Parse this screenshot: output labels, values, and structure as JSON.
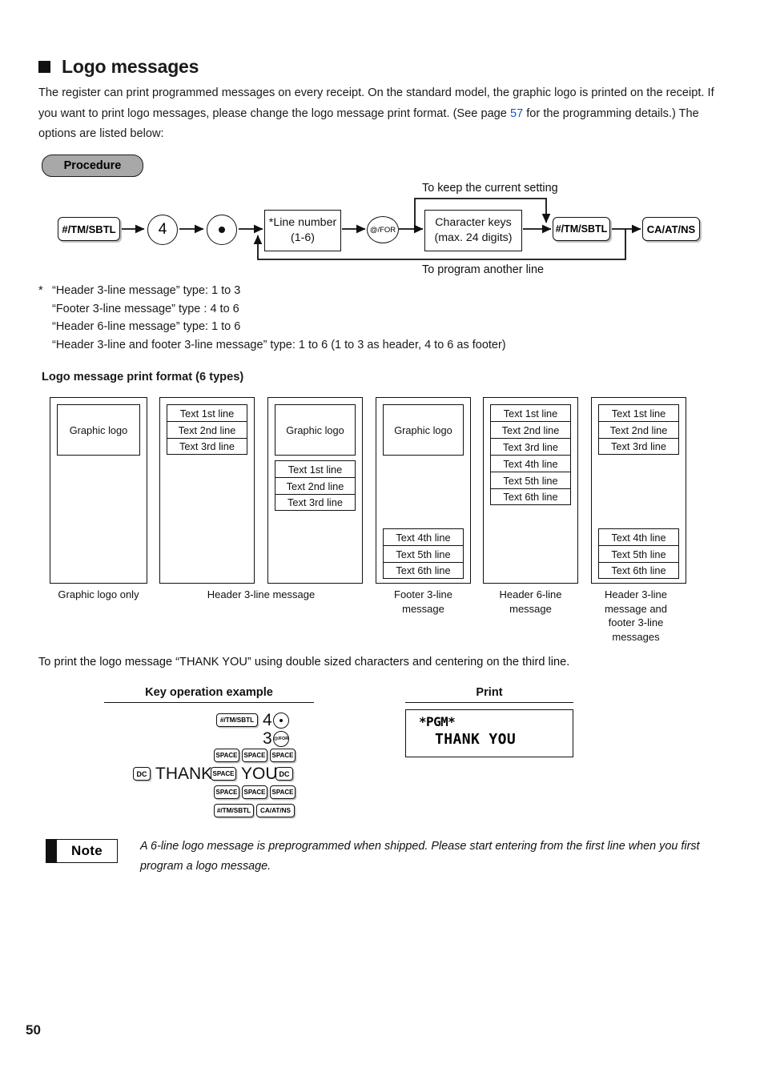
{
  "page": {
    "number": "50"
  },
  "heading": {
    "bullet_icon": "square-bullet-icon",
    "title": "Logo messages"
  },
  "intro": {
    "part1": "The register can print programmed messages on every receipt. On the standard model, the graphic logo is printed on the receipt.  If you want to print logo messages, please change the logo message print format. (See page ",
    "page_ref": "57",
    "part2": " for the programming details.)  The options are listed below:"
  },
  "procedure": {
    "badge": "Procedure",
    "keys": {
      "tmsbtl": "#/TM/SBTL",
      "four": "4",
      "dot": "•",
      "atfor": "@/FOR",
      "tmsbtl2": "#/TM/SBTL",
      "caatns": "CA/AT/NS"
    },
    "boxes": {
      "line_number_l1": "*Line number",
      "line_number_l2": "(1-6)",
      "char_keys_l1": "Character keys",
      "char_keys_l2": "(max. 24 digits)"
    },
    "labels": {
      "keep_setting": "To keep the current setting",
      "program_another": "To program another line"
    }
  },
  "footnote": {
    "star": "*",
    "lines": [
      "“Header 3-line message” type: 1 to 3",
      "“Footer 3-line message” type  : 4 to 6",
      "“Header 6-line message” type: 1 to 6",
      "“Header 3-line and footer 3-line message” type: 1 to 6 (1 to 3 as header, 4 to 6 as footer)"
    ]
  },
  "formats": {
    "subtitle": "Logo message print format (6 types)",
    "labels": {
      "graphic_logo": "Graphic logo",
      "line1": "Text 1st line",
      "line2": "Text 2nd line",
      "line3": "Text 3rd line",
      "line4": "Text 4th line",
      "line5": "Text 5th line",
      "line6": "Text 6th line"
    },
    "items": [
      {
        "caption": "Graphic logo only",
        "logo": "Graphic logo",
        "top_lines": [],
        "bottom_lines": []
      },
      {
        "caption": "Header 3-line message",
        "logo": null,
        "top_lines": [
          "Text 1st line",
          "Text 2nd line",
          "Text 3rd line"
        ],
        "bottom_lines": []
      },
      {
        "caption": "Header 3-line message",
        "logo": "Graphic logo",
        "top_lines": [
          "Text 1st line",
          "Text 2nd line",
          "Text 3rd line"
        ],
        "bottom_lines": []
      },
      {
        "caption": "Footer 3-line message",
        "logo": "Graphic logo",
        "top_lines": [],
        "bottom_lines": [
          "Text 4th line",
          "Text 5th line",
          "Text 6th line"
        ]
      },
      {
        "caption": "Header 6-line message",
        "logo": null,
        "top_lines": [
          "Text 1st line",
          "Text 2nd line",
          "Text 3rd line",
          "Text 4th line",
          "Text 5th line",
          "Text 6th line"
        ],
        "bottom_lines": []
      },
      {
        "caption": "Header 3-line message and footer 3-line messages",
        "logo": null,
        "top_lines": [
          "Text 1st line",
          "Text 2nd line",
          "Text 3rd line"
        ],
        "bottom_lines": [
          "Text 4th line",
          "Text 5th line",
          "Text 6th line"
        ]
      }
    ]
  },
  "example": {
    "sentence": "To print the logo message “THANK YOU” using double sized characters and centering on the third line.",
    "col_key_header": "Key operation example",
    "col_print_header": "Print",
    "keys": {
      "tmsbtl": "#/TM/SBTL",
      "four": "4",
      "dot": "•",
      "three": "3",
      "atfor": "@/FOR",
      "space": "SPACE",
      "dc": "DC",
      "thank": "THANK",
      "you": "YOU",
      "caatns": "CA/AT/NS"
    },
    "print": {
      "line1": "*PGM*",
      "line2": "THANK  YOU"
    }
  },
  "note": {
    "badge": "Note",
    "text": "A 6-line logo message is preprogrammed when shipped.  Please start entering from the first line when you first program a logo message."
  }
}
